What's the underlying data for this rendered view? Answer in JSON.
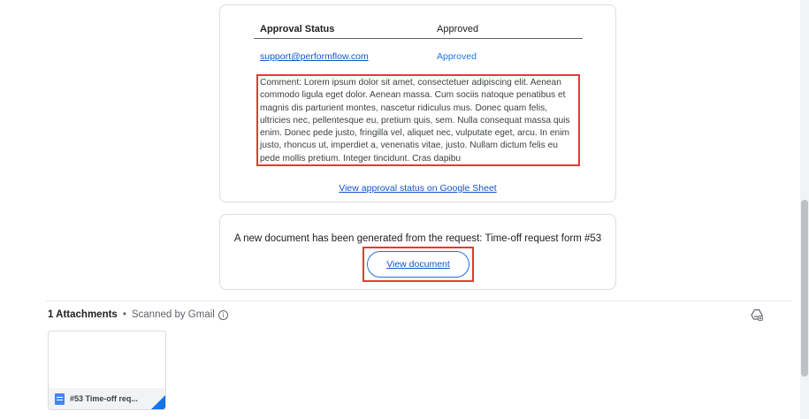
{
  "approval": {
    "header_label": "Approval Status",
    "header_value": "Approved",
    "approver_email": "support@performflow.com",
    "approver_status": "Approved",
    "comment": "Comment: Lorem ipsum dolor sit amet, consectetuer adipiscing elit. Aenean commodo ligula eget dolor. Aenean massa. Cum sociis natoque penatibus et magnis dis parturient montes, nascetur ridiculus mus. Donec quam felis, ultricies nec, pellentesque eu, pretium quis, sem. Nulla consequat massa quis enim. Donec pede justo, fringilla vel, aliquet nec, vulputate eget, arcu. In enim justo, rhoncus ut, imperdiet a, venenatis vitae, justo. Nullam dictum felis eu pede mollis pretium. Integer tincidunt. Cras dapibu",
    "sheet_link": "View approval status on Google Sheet"
  },
  "document": {
    "message": "A new document has been generated from the request: Time-off request form #53",
    "button_label": "View document"
  },
  "attachments": {
    "count_label": "1 Attachments",
    "separator": "•",
    "scanned_label": "Scanned by Gmail",
    "info_glyph": "i",
    "items": [
      {
        "name": "#53 Time-off req...",
        "icon": "google-docs-icon"
      }
    ]
  },
  "icons": {
    "add_to_drive": "add-to-drive-icon"
  },
  "colors": {
    "link": "#1155cc",
    "highlight": "#e53935",
    "button_border": "#1a73e8"
  }
}
